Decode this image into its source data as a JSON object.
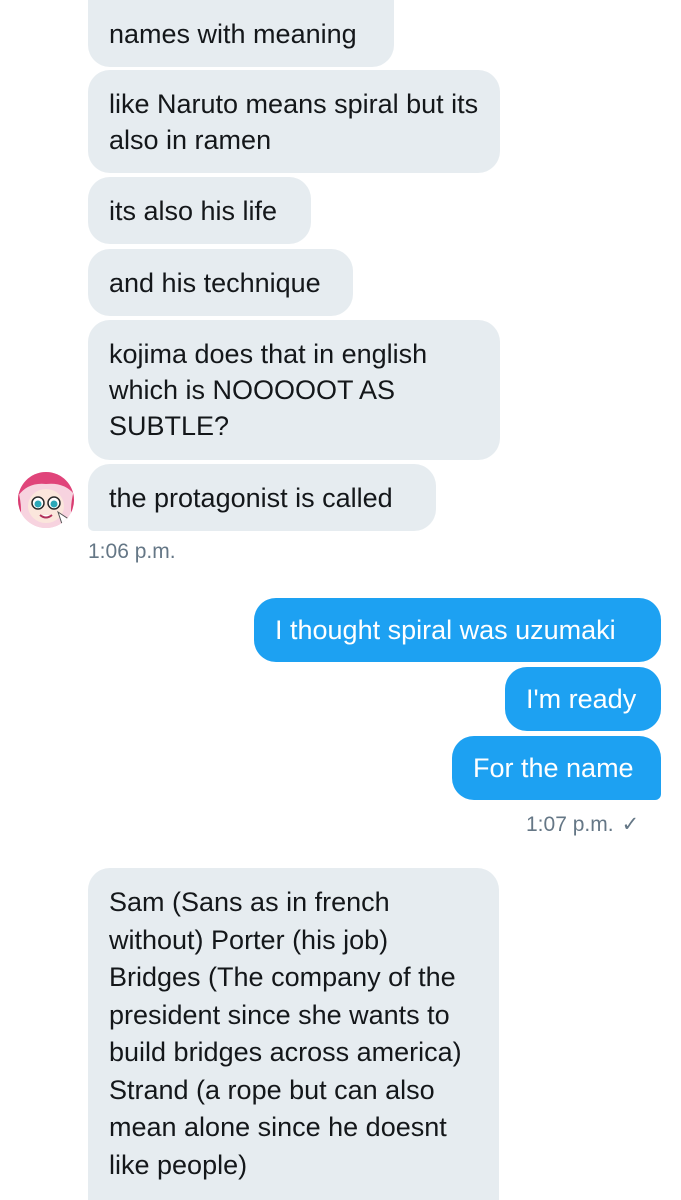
{
  "incoming_block_1": [
    "names with meaning",
    "like Naruto means spiral but its also in ramen",
    "its also his life",
    "and his technique",
    "kojima does that in english which is NOOOOOT AS SUBTLE?",
    "the protagonist is called"
  ],
  "incoming_time_1": "1:06 p.m.",
  "outgoing_block": [
    "I thought spiral was uzumaki",
    "I'm ready",
    "For the name"
  ],
  "outgoing_time": "1:07 p.m.",
  "outgoing_status": "✓",
  "incoming_block_2": [
    "Sam (Sans as in french without) Porter (his job) Bridges (The company of the president since she wants to build bridges across america) Strand (a rope but can also mean alone since he doesnt like people)"
  ],
  "colors": {
    "incoming_bg": "#e6ecf0",
    "outgoing_bg": "#1da1f2",
    "timestamp": "#657786"
  },
  "avatar_icon": "anime-avatar-icon"
}
